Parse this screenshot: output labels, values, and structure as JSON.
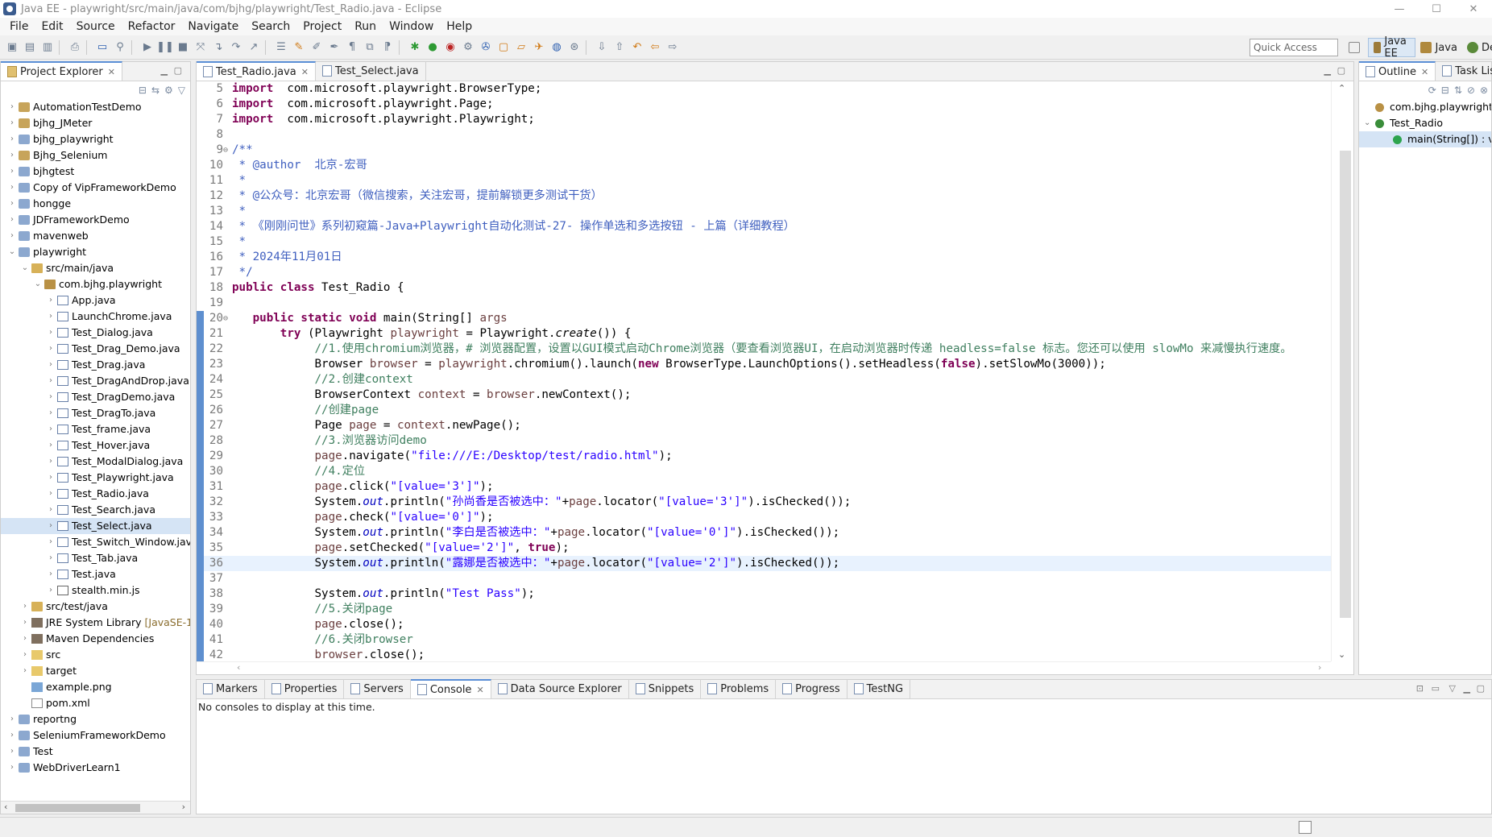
{
  "window": {
    "title": "Java EE - playwright/src/main/java/com/bjhg/playwright/Test_Radio.java - Eclipse"
  },
  "menu": [
    "File",
    "Edit",
    "Source",
    "Refactor",
    "Navigate",
    "Search",
    "Project",
    "Run",
    "Window",
    "Help"
  ],
  "toolbar": {
    "quick_access_placeholder": "Quick Access"
  },
  "perspectives": [
    {
      "label": "Java EE",
      "active": true
    },
    {
      "label": "Java",
      "active": false
    },
    {
      "label": "De",
      "active": false
    }
  ],
  "project_explorer": {
    "title": "Project Explorer",
    "items": [
      {
        "label": "AutomationTestDemo",
        "depth": 0,
        "arrow": "›",
        "icon": "proj"
      },
      {
        "label": "bjhg_JMeter",
        "depth": 0,
        "arrow": "›",
        "icon": "proj"
      },
      {
        "label": "bjhg_playwright",
        "depth": 0,
        "arrow": "›",
        "icon": "projm"
      },
      {
        "label": "Bjhg_Selenium",
        "depth": 0,
        "arrow": "›",
        "icon": "proj"
      },
      {
        "label": "bjhgtest",
        "depth": 0,
        "arrow": "›",
        "icon": "projm"
      },
      {
        "label": "Copy of VipFrameworkDemo",
        "depth": 0,
        "arrow": "›",
        "icon": "projm"
      },
      {
        "label": "hongge",
        "depth": 0,
        "arrow": "›",
        "icon": "projm"
      },
      {
        "label": "JDFrameworkDemo",
        "depth": 0,
        "arrow": "›",
        "icon": "projm"
      },
      {
        "label": "mavenweb",
        "depth": 0,
        "arrow": "›",
        "icon": "projm"
      },
      {
        "label": "playwright",
        "depth": 0,
        "arrow": "⌄",
        "icon": "projm"
      },
      {
        "label": "src/main/java",
        "depth": 1,
        "arrow": "⌄",
        "icon": "srcf"
      },
      {
        "label": "com.bjhg.playwright",
        "depth": 2,
        "arrow": "⌄",
        "icon": "pkg"
      },
      {
        "label": "App.java",
        "depth": 3,
        "arrow": "›",
        "icon": "java"
      },
      {
        "label": "LaunchChrome.java",
        "depth": 3,
        "arrow": "›",
        "icon": "java"
      },
      {
        "label": "Test_Dialog.java",
        "depth": 3,
        "arrow": "›",
        "icon": "java"
      },
      {
        "label": "Test_Drag_Demo.java",
        "depth": 3,
        "arrow": "›",
        "icon": "java"
      },
      {
        "label": "Test_Drag.java",
        "depth": 3,
        "arrow": "›",
        "icon": "java"
      },
      {
        "label": "Test_DragAndDrop.java",
        "depth": 3,
        "arrow": "›",
        "icon": "java"
      },
      {
        "label": "Test_DragDemo.java",
        "depth": 3,
        "arrow": "›",
        "icon": "java"
      },
      {
        "label": "Test_DragTo.java",
        "depth": 3,
        "arrow": "›",
        "icon": "java"
      },
      {
        "label": "Test_frame.java",
        "depth": 3,
        "arrow": "›",
        "icon": "java"
      },
      {
        "label": "Test_Hover.java",
        "depth": 3,
        "arrow": "›",
        "icon": "java"
      },
      {
        "label": "Test_ModalDialog.java",
        "depth": 3,
        "arrow": "›",
        "icon": "java"
      },
      {
        "label": "Test_Playwright.java",
        "depth": 3,
        "arrow": "›",
        "icon": "java"
      },
      {
        "label": "Test_Radio.java",
        "depth": 3,
        "arrow": "›",
        "icon": "java"
      },
      {
        "label": "Test_Search.java",
        "depth": 3,
        "arrow": "›",
        "icon": "java"
      },
      {
        "label": "Test_Select.java",
        "depth": 3,
        "arrow": "›",
        "icon": "java",
        "selected": true
      },
      {
        "label": "Test_Switch_Window.java",
        "depth": 3,
        "arrow": "›",
        "icon": "java"
      },
      {
        "label": "Test_Tab.java",
        "depth": 3,
        "arrow": "›",
        "icon": "java"
      },
      {
        "label": "Test.java",
        "depth": 3,
        "arrow": "›",
        "icon": "java"
      },
      {
        "label": "stealth.min.js",
        "depth": 3,
        "arrow": "›",
        "icon": "js"
      },
      {
        "label": "src/test/java",
        "depth": 1,
        "arrow": "›",
        "icon": "srcf"
      },
      {
        "label": "JRE System Library",
        "suffix": " [JavaSE-1.",
        "depth": 1,
        "arrow": "›",
        "icon": "lib"
      },
      {
        "label": "Maven Dependencies",
        "depth": 1,
        "arrow": "›",
        "icon": "lib"
      },
      {
        "label": "src",
        "depth": 1,
        "arrow": "›",
        "icon": "fold"
      },
      {
        "label": "target",
        "depth": 1,
        "arrow": "›",
        "icon": "fold"
      },
      {
        "label": "example.png",
        "depth": 1,
        "arrow": "",
        "icon": "png"
      },
      {
        "label": "pom.xml",
        "depth": 1,
        "arrow": "",
        "icon": "xml"
      },
      {
        "label": "reportng",
        "depth": 0,
        "arrow": "›",
        "icon": "projm"
      },
      {
        "label": "SeleniumFrameworkDemo",
        "depth": 0,
        "arrow": "›",
        "icon": "projm"
      },
      {
        "label": "Test",
        "depth": 0,
        "arrow": "›",
        "icon": "projm"
      },
      {
        "label": "WebDriverLearn1",
        "depth": 0,
        "arrow": "›",
        "icon": "projm"
      }
    ]
  },
  "editor": {
    "tabs": [
      {
        "label": "Test_Radio.java",
        "active": true
      },
      {
        "label": "Test_Select.java",
        "active": false
      }
    ],
    "highlighted_line": 36,
    "lines": [
      {
        "n": "5",
        "segs": [
          [
            "kw",
            "import"
          ],
          [
            "",
            "  com.microsoft.playwright.BrowserType;"
          ]
        ]
      },
      {
        "n": "6",
        "segs": [
          [
            "kw",
            "import"
          ],
          [
            "",
            "  com.microsoft.playwright.Page;"
          ]
        ]
      },
      {
        "n": "7",
        "segs": [
          [
            "kw",
            "import"
          ],
          [
            "",
            "  com.microsoft.playwright.Playwright;"
          ]
        ]
      },
      {
        "n": "8",
        "segs": []
      },
      {
        "n": "9",
        "fold": "⊖",
        "segs": [
          [
            "jd",
            "/**"
          ]
        ]
      },
      {
        "n": "10",
        "segs": [
          [
            "jd",
            " * @author  北京-宏哥"
          ]
        ]
      },
      {
        "n": "11",
        "segs": [
          [
            "jd",
            " *"
          ]
        ]
      },
      {
        "n": "12",
        "segs": [
          [
            "jd",
            " * @公众号：北京宏哥（微信搜索，关注宏哥，提前解锁更多测试干货）"
          ]
        ]
      },
      {
        "n": "13",
        "segs": [
          [
            "jd",
            " *"
          ]
        ]
      },
      {
        "n": "14",
        "segs": [
          [
            "jd",
            " * 《刚刚问世》系列初窥篇-Java+Playwright自动化测试-27- 操作单选和多选按钮 - 上篇（详细教程）"
          ]
        ]
      },
      {
        "n": "15",
        "segs": [
          [
            "jd",
            " *"
          ]
        ]
      },
      {
        "n": "16",
        "segs": [
          [
            "jd",
            " * 2024年11月01日"
          ]
        ]
      },
      {
        "n": "17",
        "segs": [
          [
            "jd",
            " */"
          ]
        ]
      },
      {
        "n": "18",
        "segs": [
          [
            "kw",
            "public"
          ],
          [
            "",
            " "
          ],
          [
            "kw",
            "class"
          ],
          [
            "",
            " Test_Radio {"
          ]
        ]
      },
      {
        "n": "19",
        "segs": []
      },
      {
        "n": "20",
        "fold": "⊖",
        "mod": true,
        "segs": [
          [
            "",
            "   "
          ],
          [
            "kw",
            "public"
          ],
          [
            "",
            " "
          ],
          [
            "kw",
            "static"
          ],
          [
            "",
            " "
          ],
          [
            "kw",
            "void"
          ],
          [
            "",
            " main(String[] "
          ],
          [
            "var",
            "args"
          ],
          [
            ") {"
          ]
        ]
      },
      {
        "n": "21",
        "mod": true,
        "segs": [
          [
            "",
            "       "
          ],
          [
            "kw",
            "try"
          ],
          [
            "",
            " (Playwright "
          ],
          [
            "var",
            "playwright"
          ],
          [
            "",
            " = Playwright."
          ],
          [
            "mi",
            "create"
          ],
          [
            "",
            "()) {"
          ]
        ]
      },
      {
        "n": "22",
        "mod": true,
        "segs": [
          [
            "",
            "            "
          ],
          [
            "cm",
            "//1.使用chromium浏览器，# 浏览器配置，设置以GUI模式启动Chrome浏览器（要查看浏览器UI，在启动浏览器时传递 headless=false 标志。您还可以使用 slowMo 来减慢执行速度。"
          ]
        ]
      },
      {
        "n": "23",
        "mod": true,
        "segs": [
          [
            "",
            "            Browser "
          ],
          [
            "var",
            "browser"
          ],
          [
            "",
            " = "
          ],
          [
            "var",
            "playwright"
          ],
          [
            "",
            ".chromium().launch("
          ],
          [
            "kw",
            "new"
          ],
          [
            "",
            " BrowserType.LaunchOptions().setHeadless("
          ],
          [
            "kw",
            "false"
          ],
          [
            "",
            ").setSlowMo(3000));"
          ]
        ]
      },
      {
        "n": "24",
        "mod": true,
        "segs": [
          [
            "",
            "            "
          ],
          [
            "cm",
            "//2.创建context"
          ]
        ]
      },
      {
        "n": "25",
        "mod": true,
        "segs": [
          [
            "",
            "            BrowserContext "
          ],
          [
            "var",
            "context"
          ],
          [
            "",
            " = "
          ],
          [
            "var",
            "browser"
          ],
          [
            "",
            ".newContext();"
          ]
        ]
      },
      {
        "n": "26",
        "mod": true,
        "segs": [
          [
            "",
            "            "
          ],
          [
            "cm",
            "//创建page"
          ]
        ]
      },
      {
        "n": "27",
        "mod": true,
        "segs": [
          [
            "",
            "            Page "
          ],
          [
            "var",
            "page"
          ],
          [
            "",
            " = "
          ],
          [
            "var",
            "context"
          ],
          [
            "",
            ".newPage();"
          ]
        ]
      },
      {
        "n": "28",
        "mod": true,
        "segs": [
          [
            "",
            "            "
          ],
          [
            "cm",
            "//3.浏览器访问demo"
          ]
        ]
      },
      {
        "n": "29",
        "mod": true,
        "segs": [
          [
            "",
            "            "
          ],
          [
            "var",
            "page"
          ],
          [
            "",
            ".navigate("
          ],
          [
            "str",
            "\"file:///E:/Desktop/test/radio.html\""
          ],
          [
            "",
            ");"
          ]
        ]
      },
      {
        "n": "30",
        "mod": true,
        "segs": [
          [
            "",
            "            "
          ],
          [
            "cm",
            "//4.定位"
          ]
        ]
      },
      {
        "n": "31",
        "mod": true,
        "segs": [
          [
            "",
            "            "
          ],
          [
            "var",
            "page"
          ],
          [
            "",
            ".click("
          ],
          [
            "str",
            "\"[value='3']\""
          ],
          [
            "",
            ");"
          ]
        ]
      },
      {
        "n": "32",
        "mod": true,
        "segs": [
          [
            "",
            "            System."
          ],
          [
            "fld",
            "out"
          ],
          [
            "",
            ".println("
          ],
          [
            "str",
            "\"孙尚香是否被选中：\""
          ],
          [
            "",
            "+"
          ],
          [
            "var",
            "page"
          ],
          [
            "",
            ".locator("
          ],
          [
            "str",
            "\"[value='3']\""
          ],
          [
            "",
            ").isChecked());"
          ]
        ]
      },
      {
        "n": "33",
        "mod": true,
        "segs": [
          [
            "",
            "            "
          ],
          [
            "var",
            "page"
          ],
          [
            "",
            ".check("
          ],
          [
            "str",
            "\"[value='0']\""
          ],
          [
            "",
            ");"
          ]
        ]
      },
      {
        "n": "34",
        "mod": true,
        "segs": [
          [
            "",
            "            System."
          ],
          [
            "fld",
            "out"
          ],
          [
            "",
            ".println("
          ],
          [
            "str",
            "\"李白是否被选中：\""
          ],
          [
            "",
            "+"
          ],
          [
            "var",
            "page"
          ],
          [
            "",
            ".locator("
          ],
          [
            "str",
            "\"[value='0']\""
          ],
          [
            "",
            ").isChecked());"
          ]
        ]
      },
      {
        "n": "35",
        "mod": true,
        "segs": [
          [
            "",
            "            "
          ],
          [
            "var",
            "page"
          ],
          [
            "",
            ".setChecked("
          ],
          [
            "str",
            "\"[value='2']\""
          ],
          [
            "",
            ", "
          ],
          [
            "kw",
            "true"
          ],
          [
            "",
            ");"
          ]
        ]
      },
      {
        "n": "36",
        "mod": true,
        "segs": [
          [
            "",
            "            System."
          ],
          [
            "fld",
            "out"
          ],
          [
            "",
            ".println("
          ],
          [
            "str",
            "\"露娜是否被选中：\""
          ],
          [
            "",
            "+"
          ],
          [
            "var",
            "page"
          ],
          [
            "",
            ".locator("
          ],
          [
            "str",
            "\"[value='2']\""
          ],
          [
            "",
            ").isChecked());"
          ]
        ]
      },
      {
        "n": "37",
        "mod": true,
        "segs": []
      },
      {
        "n": "38",
        "mod": true,
        "segs": [
          [
            "",
            "            System."
          ],
          [
            "fld",
            "out"
          ],
          [
            "",
            ".println("
          ],
          [
            "str",
            "\"Test Pass\""
          ],
          [
            "",
            ");"
          ]
        ]
      },
      {
        "n": "39",
        "mod": true,
        "segs": [
          [
            "",
            "            "
          ],
          [
            "cm",
            "//5.关闭page"
          ]
        ]
      },
      {
        "n": "40",
        "mod": true,
        "segs": [
          [
            "",
            "            "
          ],
          [
            "var",
            "page"
          ],
          [
            "",
            ".close();"
          ]
        ]
      },
      {
        "n": "41",
        "mod": true,
        "segs": [
          [
            "",
            "            "
          ],
          [
            "cm",
            "//6.关闭browser"
          ]
        ]
      },
      {
        "n": "42",
        "mod": true,
        "segs": [
          [
            "",
            "            "
          ],
          [
            "var",
            "browser"
          ],
          [
            "",
            ".close();"
          ]
        ]
      }
    ]
  },
  "outline": {
    "tabs": [
      {
        "label": "Outline",
        "active": true
      },
      {
        "label": "Task List",
        "active": false
      }
    ],
    "items": [
      {
        "label": "com.bjhg.playwright",
        "depth": 0,
        "arrow": ""
      },
      {
        "label": "Test_Radio",
        "depth": 0,
        "arrow": "⌄"
      },
      {
        "label": "main(String[]) : void",
        "depth": 1,
        "arrow": "",
        "selected": true
      }
    ]
  },
  "bottom": {
    "tabs": [
      "Markers",
      "Properties",
      "Servers",
      "Console",
      "Data Source Explorer",
      "Snippets",
      "Problems",
      "Progress",
      "TestNG"
    ],
    "active_tab": "Console",
    "message": "No consoles to display at this time."
  },
  "colors": {
    "keyword": "#7f0055",
    "string": "#2a00ff",
    "comment": "#3f7f5f",
    "javadoc": "#3f5fbf",
    "selection": "#d5e4f5",
    "accent": "#5b8fd6"
  }
}
